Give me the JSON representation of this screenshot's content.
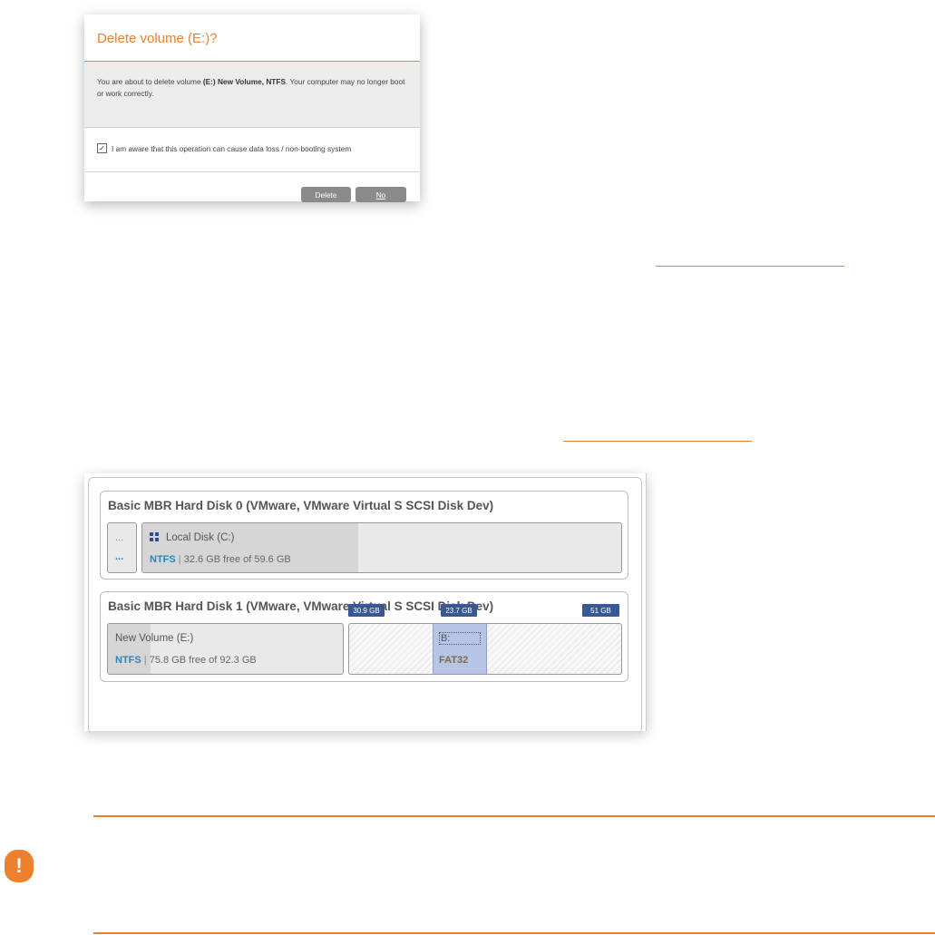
{
  "dialog": {
    "title": "Delete volume (E:)?",
    "message_part1": "You are about to delete volume ",
    "message_bold1": "(E:) New Volume, NTFS",
    "message_part2": ". Your computer may no longer boot or work correctly.",
    "checkbox_checked": true,
    "checkbox_mark": "✓",
    "checkbox_label": "I am aware that this operation can cause data loss / non-booting system",
    "delete_label": "Delete",
    "no_label": "No"
  },
  "diskmap": {
    "disk0": {
      "title": "Basic MBR Hard Disk 0 (VMware, VMware Virtual S SCSI Disk Dev)",
      "small_part": {
        "top": "...",
        "bottom": "..."
      },
      "local": {
        "name": "Local Disk (C:)",
        "fs": "NTFS",
        "sep": "|",
        "info": "32.6 GB free of 59.6 GB",
        "used_fraction": 0.45
      }
    },
    "disk1": {
      "title": "Basic MBR Hard Disk 1 (VMware, VMware Virtual S SCSI Disk Dev)",
      "newvol": {
        "name": "New Volume (E:)",
        "fs": "NTFS",
        "sep": "|",
        "info": "75.8 GB free of 92.3 GB",
        "used_fraction": 0.18
      },
      "unalloc_part": {
        "letter": "B:",
        "fs": "FAT32"
      },
      "tags": {
        "left": "30.9 GB",
        "mid": "23.7 GB",
        "right": "51 GB"
      }
    }
  },
  "colors": {
    "accent": "#ee7f2d",
    "tag": "#3a5795",
    "fs_label": "#2b85b6"
  },
  "icons": {
    "notice": "exclamation-icon",
    "windows": "windows-logo-icon"
  },
  "notice_glyph": "!"
}
